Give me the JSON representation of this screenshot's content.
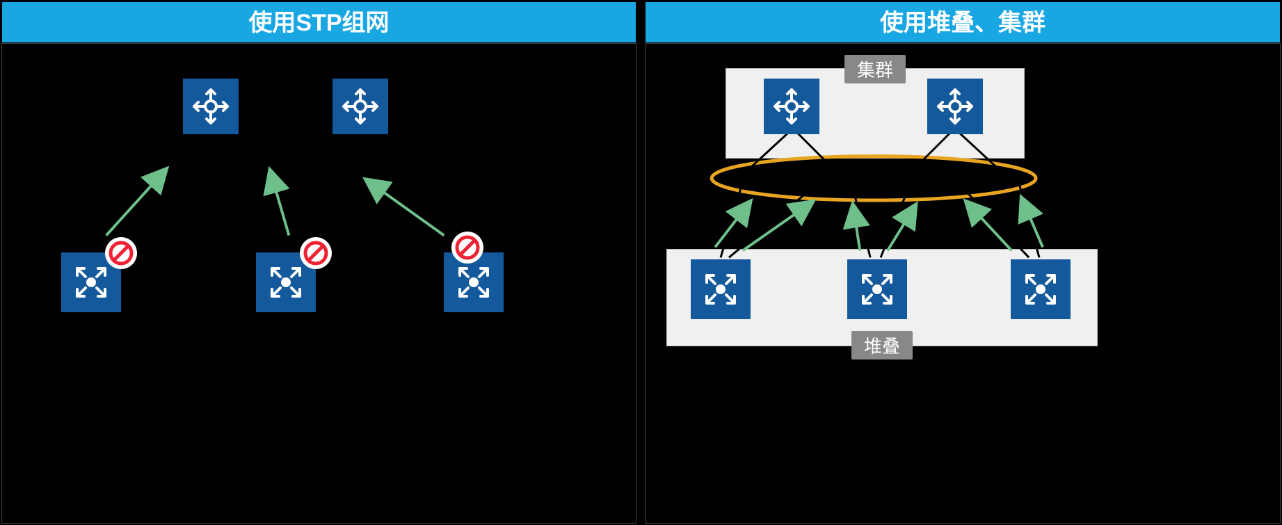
{
  "left": {
    "title": "使用STP组网"
  },
  "right": {
    "title": "使用堆叠、集群",
    "cluster_label": "集群",
    "stack_label": "堆叠"
  }
}
